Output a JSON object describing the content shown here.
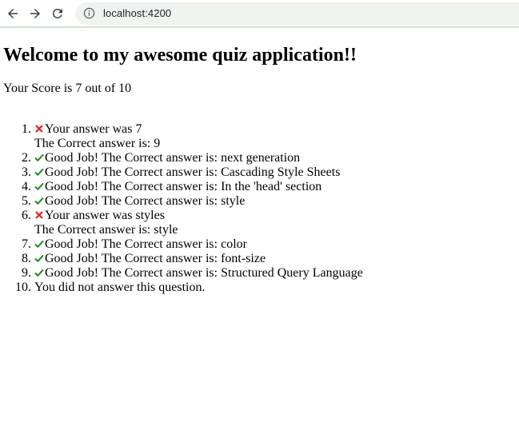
{
  "browser": {
    "url": "localhost:4200",
    "icons": {
      "back": "arrow-left-icon",
      "forward": "arrow-right-icon",
      "reload": "reload-icon",
      "info": "info-icon"
    }
  },
  "page": {
    "title": "Welcome to my awesome quiz application!!",
    "score_text": "Your Score is 7 out of 10"
  },
  "results": [
    {
      "status": "wrong",
      "text": "Your answer was 7",
      "correct": "The Correct answer is: 9"
    },
    {
      "status": "correct",
      "text": "Good Job! The Correct answer is: next generation"
    },
    {
      "status": "correct",
      "text": "Good Job! The Correct answer is: Cascading Style Sheets"
    },
    {
      "status": "correct",
      "text": "Good Job! The Correct answer is: In the 'head' section"
    },
    {
      "status": "correct",
      "text": "Good Job! The Correct answer is: style"
    },
    {
      "status": "wrong",
      "text": "Your answer was styles",
      "correct": "The Correct answer is: style"
    },
    {
      "status": "correct",
      "text": "Good Job! The Correct answer is: color"
    },
    {
      "status": "correct",
      "text": "Good Job! The Correct answer is: font-size"
    },
    {
      "status": "correct",
      "text": "Good Job! The Correct answer is: Structured Query Language"
    },
    {
      "status": "unanswered",
      "text": "You did not answer this question."
    }
  ],
  "colors": {
    "check": "#1e8a1e",
    "cross": "#e02020"
  }
}
